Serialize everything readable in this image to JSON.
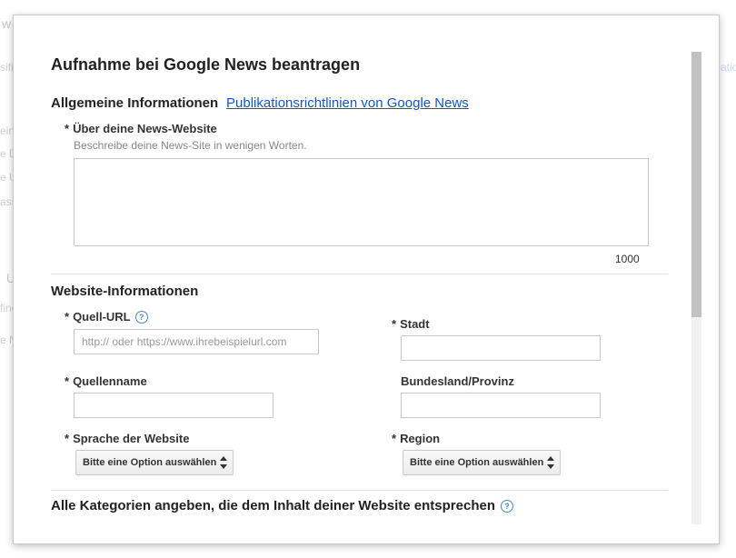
{
  "background_fragments": {
    "a": "w",
    "b": "sifi",
    "c": "ein",
    "d": "e D",
    "e": "e U",
    "f": "ass",
    "g": "U",
    "h": "fine",
    "i": "e N",
    "j": "ation"
  },
  "dialog": {
    "title": "Aufnahme bei Google News beantragen",
    "general": {
      "heading": "Allgemeine Informationen",
      "link": "Publikationsrichtlinien von Google News",
      "about_label": "Über deine News-Website",
      "about_hint": "Beschreibe deine News-Site in wenigen Worten.",
      "about_value": "",
      "char_counter": "1000"
    },
    "website": {
      "heading": "Website-Informationen",
      "source_url_label": "Quell-URL",
      "source_url_placeholder": "http:// oder https://www.ihrebeispielurl.com",
      "source_url_value": "",
      "source_name_label": "Quellenname",
      "source_name_value": "",
      "language_label": "Sprache der Website",
      "language_select": "Bitte eine Option auswählen",
      "city_label": "Stadt",
      "city_value": "",
      "state_label": "Bundesland/Provinz",
      "state_value": "",
      "region_label": "Region",
      "region_select": "Bitte eine Option auswählen"
    },
    "categories_heading": "Alle Kategorien angeben, die dem Inhalt deiner Website entsprechen",
    "required_marker": "*",
    "help_glyph": "?"
  },
  "colors": {
    "link": "#1155cc",
    "help_icon": "#4a86c8",
    "border": "#c8c8c8"
  }
}
